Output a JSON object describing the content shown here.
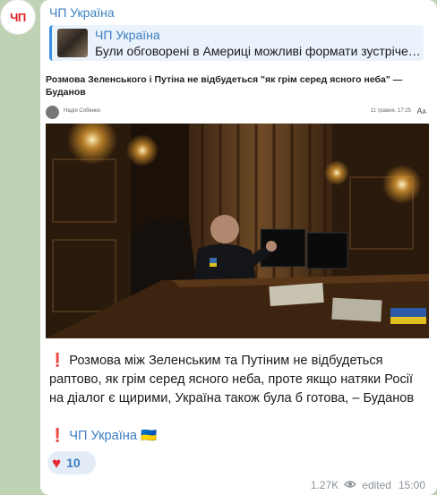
{
  "channel": {
    "avatar_text": "ЧП",
    "sender_name": "ЧП Україна"
  },
  "reply": {
    "title": "ЧП Україна",
    "text": "Були обговорені в Америці можливі формати зустріче…"
  },
  "article": {
    "title": "Розмова Зеленського і Путіна не відбудеться \"як грім серед ясного неба\" — Буданов",
    "author": "Надія Собенко",
    "date": "11 травня, 17:25",
    "font_icon": "Aᴀ"
  },
  "message": {
    "excl_icon": "❗",
    "body": "Розмова між Зеленським та Путіним не відбудеться раптово, як грім серед ясного неба, проте якщо натяки Росії на діалог є щирими, Україна також була б готова, – Буданов",
    "signature_excl": "❗",
    "signature_link": "ЧП Україна",
    "signature_flag": "🇺🇦"
  },
  "reaction": {
    "emoji": "♥",
    "count": "10"
  },
  "meta": {
    "views": "1.27K",
    "edited": "edited",
    "time": "15:00"
  },
  "colors": {
    "background": "#bfd3b4",
    "accent": "#3a7ec1",
    "reply_bar": "#3a8fe0",
    "heart": "#e52535"
  }
}
